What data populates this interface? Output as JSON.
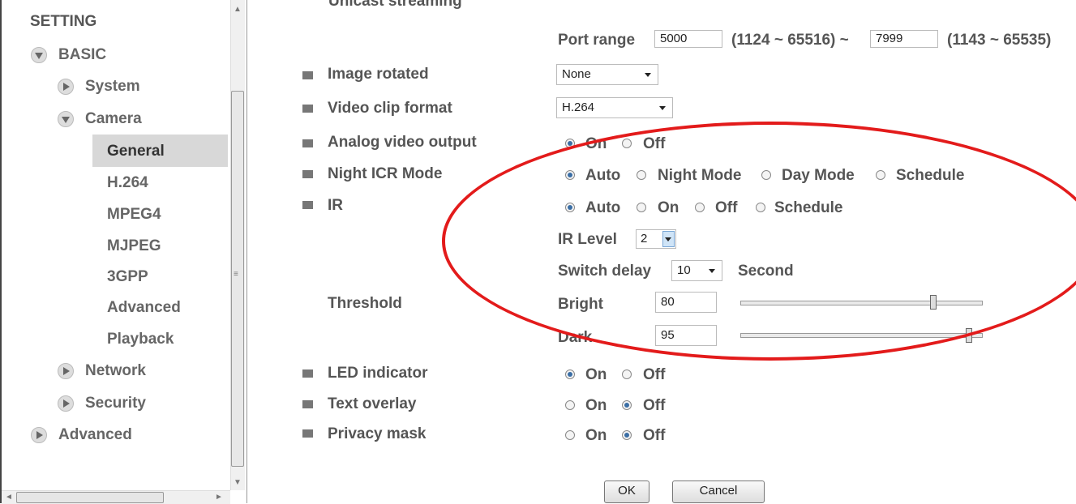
{
  "sidebar": {
    "title": "SETTING",
    "basic": "BASIC",
    "system": "System",
    "camera": "Camera",
    "camera_items": [
      "General",
      "H.264",
      "MPEG4",
      "MJPEG",
      "3GPP",
      "Advanced",
      "Playback"
    ],
    "network": "Network",
    "security": "Security",
    "advanced": "Advanced",
    "selected": "General"
  },
  "main": {
    "cut_heading": "Unicast streaming",
    "port_range": {
      "label": "Port range",
      "from": "5000",
      "from_hint": "(1124 ~ 65516) ~",
      "to": "7999",
      "to_hint": "(1143 ~ 65535)"
    },
    "image_rotated": {
      "label": "Image rotated",
      "value": "None"
    },
    "video_clip_format": {
      "label": "Video clip format",
      "value": "H.264"
    },
    "analog_video_output": {
      "label": "Analog video output",
      "options": [
        "On",
        "Off"
      ],
      "selected": "On"
    },
    "night_icr_mode": {
      "label": "Night ICR Mode",
      "options": [
        "Auto",
        "Night Mode",
        "Day Mode",
        "Schedule"
      ],
      "selected": "Auto"
    },
    "ir": {
      "label": "IR",
      "options": [
        "Auto",
        "On",
        "Off",
        "Schedule"
      ],
      "selected": "Auto"
    },
    "ir_level": {
      "label": "IR Level",
      "value": "2"
    },
    "switch_delay": {
      "label": "Switch delay",
      "value": "10",
      "unit": "Second"
    },
    "threshold": {
      "label": "Threshold",
      "bright_label": "Bright",
      "bright_value": "80",
      "dark_label": "Dark",
      "dark_value": "95",
      "bright_level": 0.8,
      "dark_level": 0.95
    },
    "led_indicator": {
      "label": "LED indicator",
      "options": [
        "On",
        "Off"
      ],
      "selected": "On"
    },
    "text_overlay": {
      "label": "Text overlay",
      "options": [
        "On",
        "Off"
      ],
      "selected": "Off"
    },
    "privacy_mask": {
      "label": "Privacy mask",
      "options": [
        "On",
        "Off"
      ],
      "selected": "Off"
    },
    "ok_label": "OK",
    "cancel_label": "Cancel"
  },
  "colors": {
    "annotation_ellipse": "#e31b1b",
    "radio_selected": "#3a6ea5"
  }
}
